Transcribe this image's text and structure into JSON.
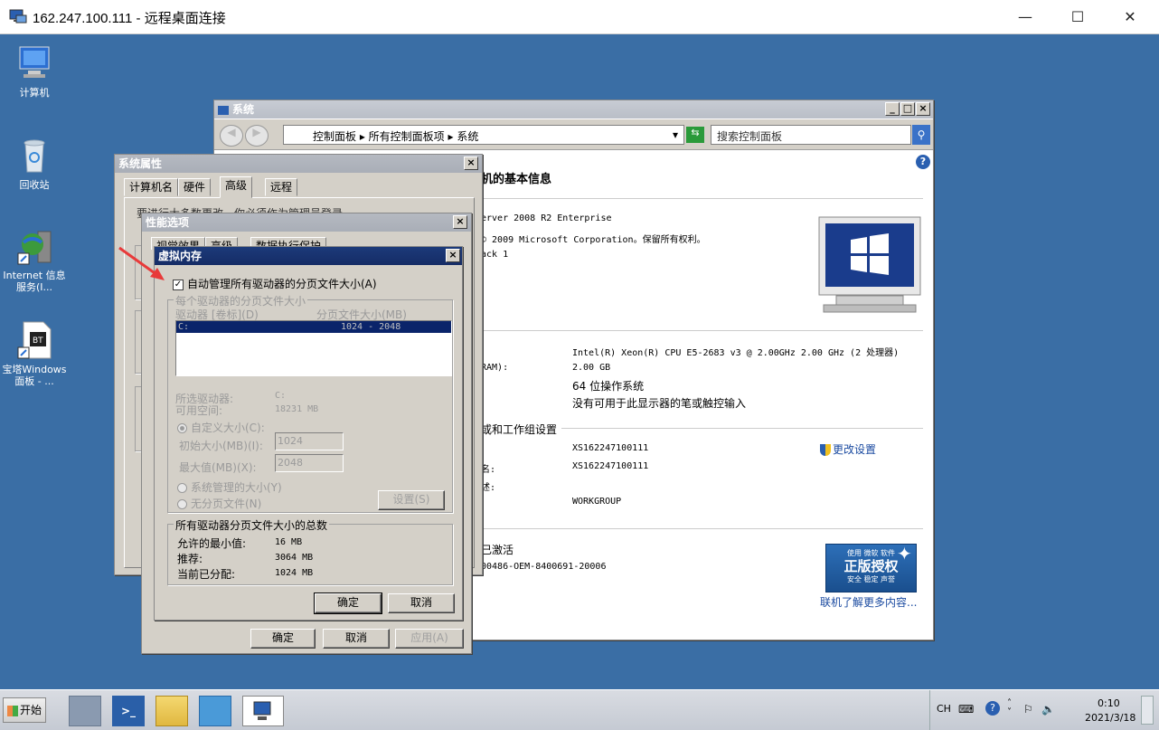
{
  "rdp": {
    "title": "162.247.100.111 - 远程桌面连接"
  },
  "desktop_icons": [
    {
      "label": "计算机"
    },
    {
      "label": "回收站"
    },
    {
      "label": "Internet 信息服务(I..."
    },
    {
      "label": "宝塔Windows面板 - ..."
    }
  ],
  "sysinfo": {
    "title": "系统",
    "breadcrumb": [
      "控制面板",
      "所有控制面板项",
      "系统"
    ],
    "search_placeholder": "搜索控制面板",
    "heading": "机的基本信息",
    "edition": "erver 2008 R2 Enterprise",
    "copyright": "© 2009 Microsoft Corporation。保留所有权利。",
    "sp": "ack 1",
    "processor": "Intel(R) Xeon(R) CPU E5-2683 v3 @ 2.00GHz   2.00 GHz  (2 处理器)",
    "ram_label": "RAM):",
    "ram": "2.00 GB",
    "systype": "64 位操作系统",
    "pen": "没有可用于此显示器的笔或触控输入",
    "domain_section": "或和工作组设置",
    "computer_name": "XS162247100111",
    "full_name_label": "名:",
    "full_name": "XS162247100111",
    "desc_label": "述:",
    "workgroup": "WORKGROUP",
    "change_settings": "更改设置",
    "activation_section": "已激活",
    "product_id": "00486-OEM-8400691-20006",
    "badge_line1": "使用 微软 软件",
    "badge_line2": "正版授权",
    "badge_line3": "安全 稳定 声誉",
    "learn_more": "联机了解更多内容..."
  },
  "sysprops": {
    "title": "系统属性",
    "tabs": [
      "计算机名",
      "硬件",
      "高级",
      "远程"
    ],
    "behind_text": "要进行大多数更改，你必须作为管理员登录"
  },
  "perf": {
    "title": "性能选项",
    "tabs": [
      "视觉效果",
      "高级",
      "数据执行保护"
    ],
    "ok": "确定",
    "cancel": "取消",
    "apply": "应用(A)"
  },
  "vmem": {
    "title": "虚拟内存",
    "auto_manage": "自动管理所有驱动器的分页文件大小(A)",
    "group_title": "每个驱动器的分页文件大小",
    "col_drive": "驱动器 [卷标](D)",
    "col_size": "分页文件大小(MB)",
    "row_drive": "C:",
    "row_size": "1024 - 2048",
    "selected_drive_label": "所选驱动器:",
    "selected_drive": "C:",
    "free_space_label": "可用空间:",
    "free_space": "18231 MB",
    "custom_size": "自定义大小(C):",
    "initial_label": "初始大小(MB)(I):",
    "initial_value": "1024",
    "max_label": "最大值(MB)(X):",
    "max_value": "2048",
    "system_managed": "系统管理的大小(Y)",
    "no_paging": "无分页文件(N)",
    "set_button": "设置(S)",
    "total_title": "所有驱动器分页文件大小的总数",
    "min_label": "允许的最小值:",
    "min_value": "16 MB",
    "rec_label": "推荐:",
    "rec_value": "3064 MB",
    "cur_label": "当前已分配:",
    "cur_value": "1024 MB",
    "ok": "确定",
    "cancel": "取消"
  },
  "taskbar": {
    "start": "开始",
    "lang": "CH",
    "time": "0:10",
    "date": "2021/3/18"
  },
  "colors": {
    "desktop": "#3a6ea5",
    "title_active": "#1c3a7a",
    "selection": "#0a246a",
    "arrow": "#e83a3a"
  }
}
